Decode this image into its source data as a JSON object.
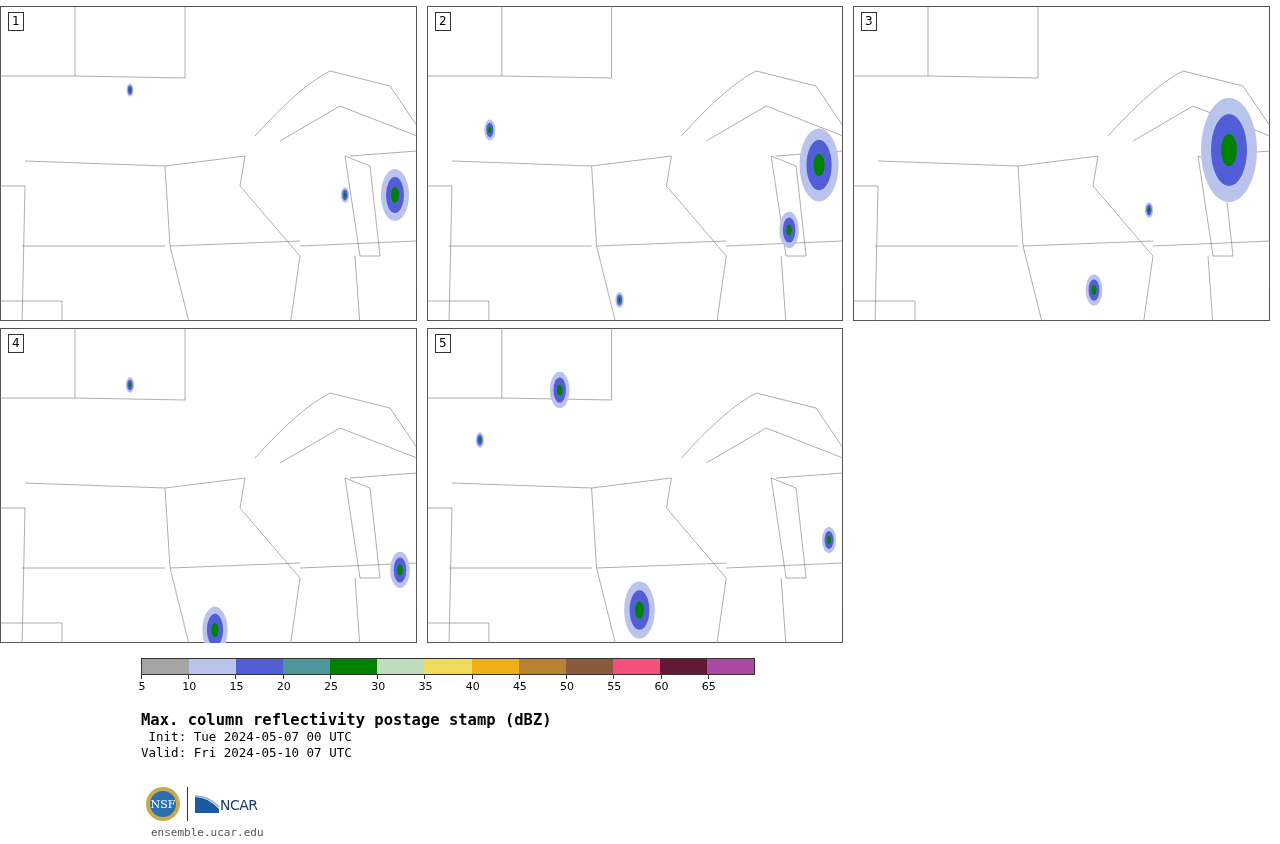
{
  "panels": [
    {
      "label": "1"
    },
    {
      "label": "2"
    },
    {
      "label": "3"
    },
    {
      "label": "4"
    },
    {
      "label": "5"
    }
  ],
  "colorbar": [
    {
      "color": "#a5a5a5",
      "label": "5"
    },
    {
      "color": "#b9c3ec",
      "label": "10"
    },
    {
      "color": "#525ed6",
      "label": "15"
    },
    {
      "color": "#4f959c",
      "label": "20"
    },
    {
      "color": "#008200",
      "label": "25"
    },
    {
      "color": "#bfdcbf",
      "label": "30"
    },
    {
      "color": "#f0da5c",
      "label": "35"
    },
    {
      "color": "#f0ae18",
      "label": "40"
    },
    {
      "color": "#b98232",
      "label": "45"
    },
    {
      "color": "#8b5a3c",
      "label": "50"
    },
    {
      "color": "#f5507a",
      "label": "55"
    },
    {
      "color": "#641838",
      "label": "60"
    },
    {
      "color": "#aa4aa4",
      "label": "65"
    }
  ],
  "title": "Max. column reflectivity postage stamp (dBZ)",
  "init": " Init: Tue 2024-05-07 00 UTC",
  "valid": "Valid: Fri 2024-05-10 07 UTC",
  "logo": {
    "seal": "NSF",
    "name": "NCAR"
  },
  "site": "ensemble.ucar.edu"
}
